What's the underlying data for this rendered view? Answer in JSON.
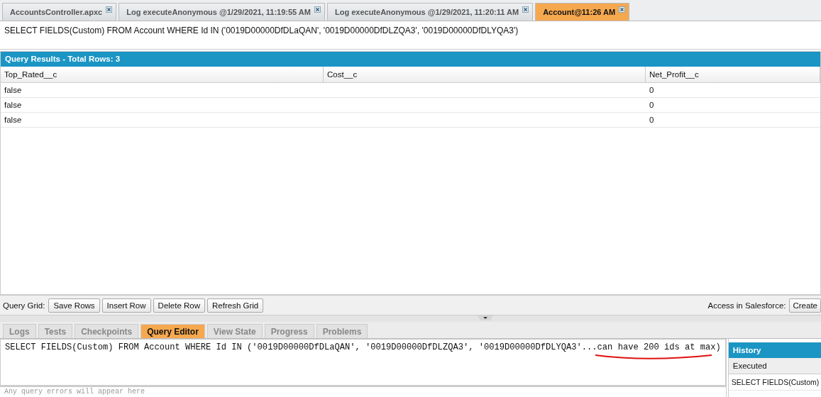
{
  "editor_tabs": [
    {
      "label": "AccountsController.apxc",
      "selected": false
    },
    {
      "label": "Log executeAnonymous @1/29/2021, 11:19:55 AM",
      "selected": false
    },
    {
      "label": "Log executeAnonymous @1/29/2021, 11:20:11 AM",
      "selected": false
    },
    {
      "label": "Account@11:26 AM",
      "selected": true
    }
  ],
  "query_text": "SELECT FIELDS(Custom) FROM Account WHERE Id IN ('0019D00000DfDLaQAN', '0019D00000DfDLZQA3', '0019D00000DfDLYQA3')",
  "results": {
    "title": "Query Results - Total Rows: 3",
    "columns": [
      "Top_Rated__c",
      "Cost__c",
      "Net_Profit__c"
    ],
    "rows": [
      [
        "false",
        "",
        "0"
      ],
      [
        "false",
        "",
        "0"
      ],
      [
        "false",
        "",
        "0"
      ]
    ]
  },
  "query_grid": {
    "label": "Query Grid:",
    "buttons": [
      "Save Rows",
      "Insert Row",
      "Delete Row",
      "Refresh Grid"
    ],
    "access_label": "Access in Salesforce:",
    "access_button": "Create"
  },
  "bottom_tabs": [
    {
      "label": "Logs",
      "selected": false
    },
    {
      "label": "Tests",
      "selected": false
    },
    {
      "label": "Checkpoints",
      "selected": false
    },
    {
      "label": "Query Editor",
      "selected": true
    },
    {
      "label": "View State",
      "selected": false
    },
    {
      "label": "Progress",
      "selected": false
    },
    {
      "label": "Problems",
      "selected": false
    }
  ],
  "query_editor": {
    "value": "SELECT FIELDS(Custom) FROM Account WHERE Id IN ('0019D00000DfDLaQAN', '0019D00000DfDLZQA3', '0019D00000DfDLYQA3'...can have 200 ids at max)",
    "errors_placeholder": "Any query errors will appear here"
  },
  "history": {
    "title": "History",
    "column": "Executed",
    "rows": [
      "SELECT FIELDS(Custom)"
    ]
  }
}
